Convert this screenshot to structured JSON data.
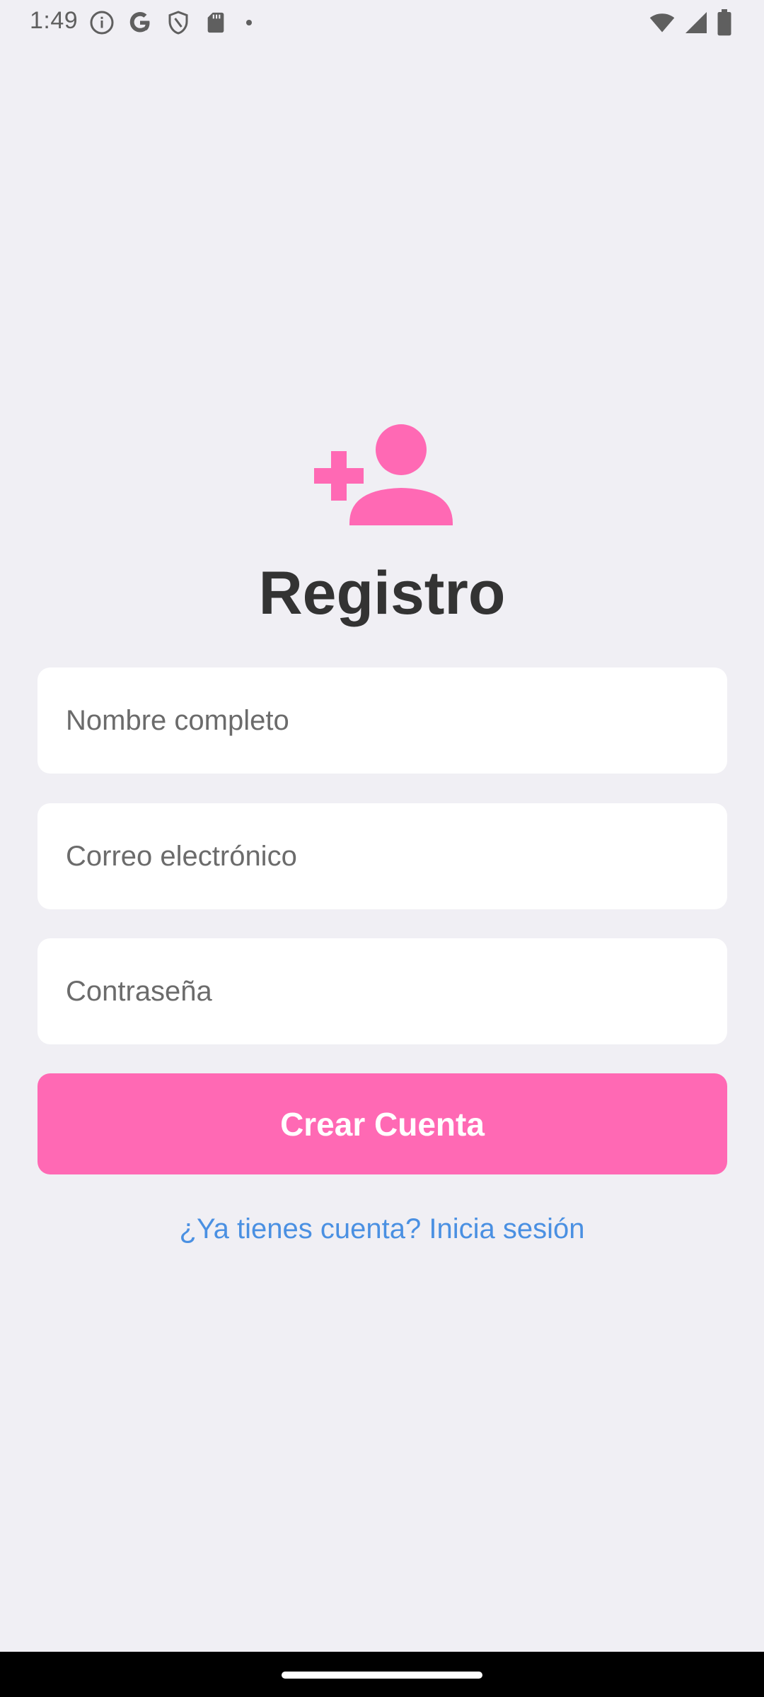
{
  "status_bar": {
    "time": "1:49",
    "left_icons": [
      "info-icon",
      "google-icon",
      "shield-icon",
      "sd-card-icon",
      "dot-icon"
    ],
    "right_icons": [
      "wifi-icon",
      "signal-icon",
      "battery-icon"
    ]
  },
  "register": {
    "icon": "person-add-icon",
    "title": "Registro",
    "fields": {
      "name_placeholder": "Nombre completo",
      "email_placeholder": "Correo electrónico",
      "password_placeholder": "Contraseña"
    },
    "create_button_label": "Crear Cuenta",
    "login_link": "¿Ya tienes cuenta? Inicia sesión"
  },
  "colors": {
    "background": "#f0eff4",
    "accent": "#ff69b4",
    "link": "#4a90e2",
    "title": "#333333"
  }
}
